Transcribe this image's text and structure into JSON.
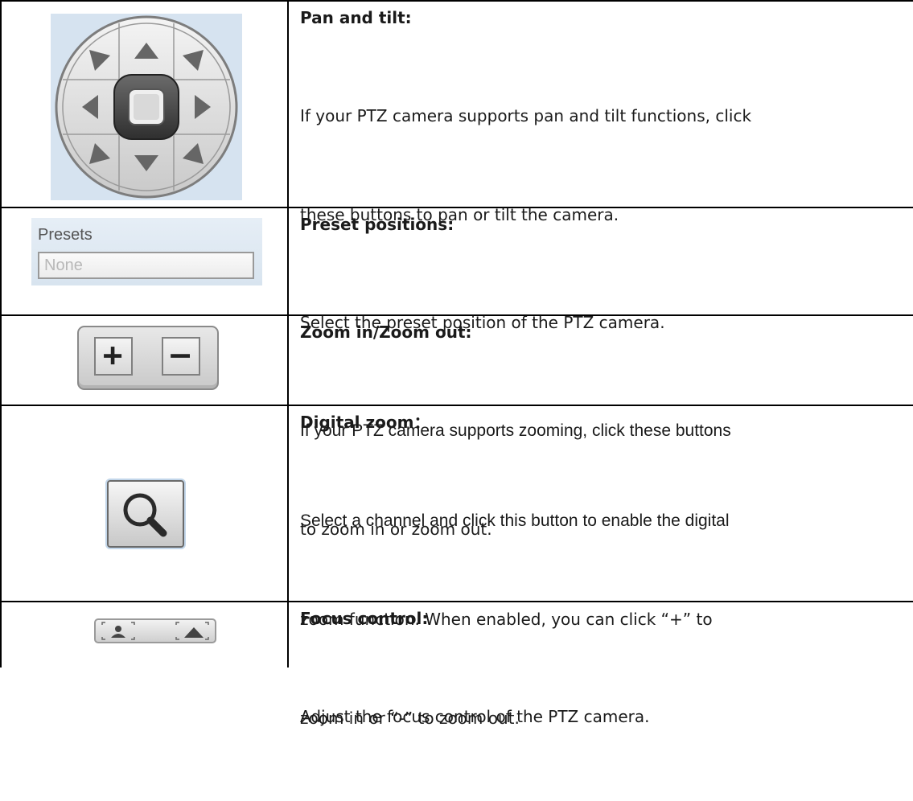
{
  "rows": [
    {
      "title": "Pan and tilt:",
      "lines": [
        "If your PTZ camera supports pan and tilt functions, click",
        "these buttons to pan or tilt the camera."
      ],
      "icon": "pan-tilt-control"
    },
    {
      "title": "Preset positions:",
      "lines": [
        "Select the preset position of the PTZ camera."
      ],
      "icon": "presets-dropdown",
      "presets": {
        "label": "Presets",
        "value": "None"
      }
    },
    {
      "title": "Zoom in/Zoom out:",
      "lines": [
        "If your PTZ camera supports zooming, click these buttons",
        "to zoom in or zoom out."
      ],
      "icon": "zoom-buttons",
      "buttons": [
        "+",
        "−"
      ]
    },
    {
      "title": "Digital zoom：",
      "lines": [
        "Select a channel and click this button to enable the digital",
        "zoom function.   When enabled, you can click “+” to",
        "zoom in or “-” to zoom out."
      ],
      "icon": "magnifier-icon"
    },
    {
      "title": "Focus control:",
      "lines": [
        "Adjust the focus control of the PTZ camera."
      ],
      "icon": "focus-control"
    }
  ],
  "colors": {
    "border": "#000000",
    "panel_bg": "#d6e3f0",
    "control_gray": "#cfcfcf"
  }
}
